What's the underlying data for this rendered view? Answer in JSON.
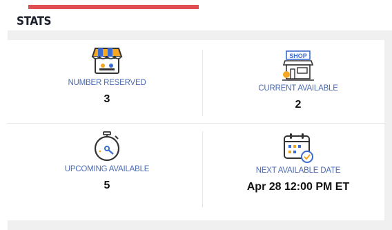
{
  "header": {
    "title": "STATS"
  },
  "stats": [
    {
      "label": "NUMBER RESERVED",
      "value": "3",
      "icon": "store-awning-icon"
    },
    {
      "label": "CURRENT AVAILABLE",
      "value": "2",
      "icon": "shop-icon",
      "icon_text": "SHOP"
    },
    {
      "label": "UPCOMING AVAILABLE",
      "value": "5",
      "icon": "stopwatch-icon"
    },
    {
      "label": "NEXT AVAILABLE DATE",
      "value": "Apr 28 12:00 PM ET",
      "icon": "calendar-check-icon"
    }
  ],
  "colors": {
    "accent_red": "#e04f4f",
    "label_blue": "#4a6ab3",
    "swoosh_blue": "#1d3f8f",
    "icon_orange": "#f5a623"
  }
}
